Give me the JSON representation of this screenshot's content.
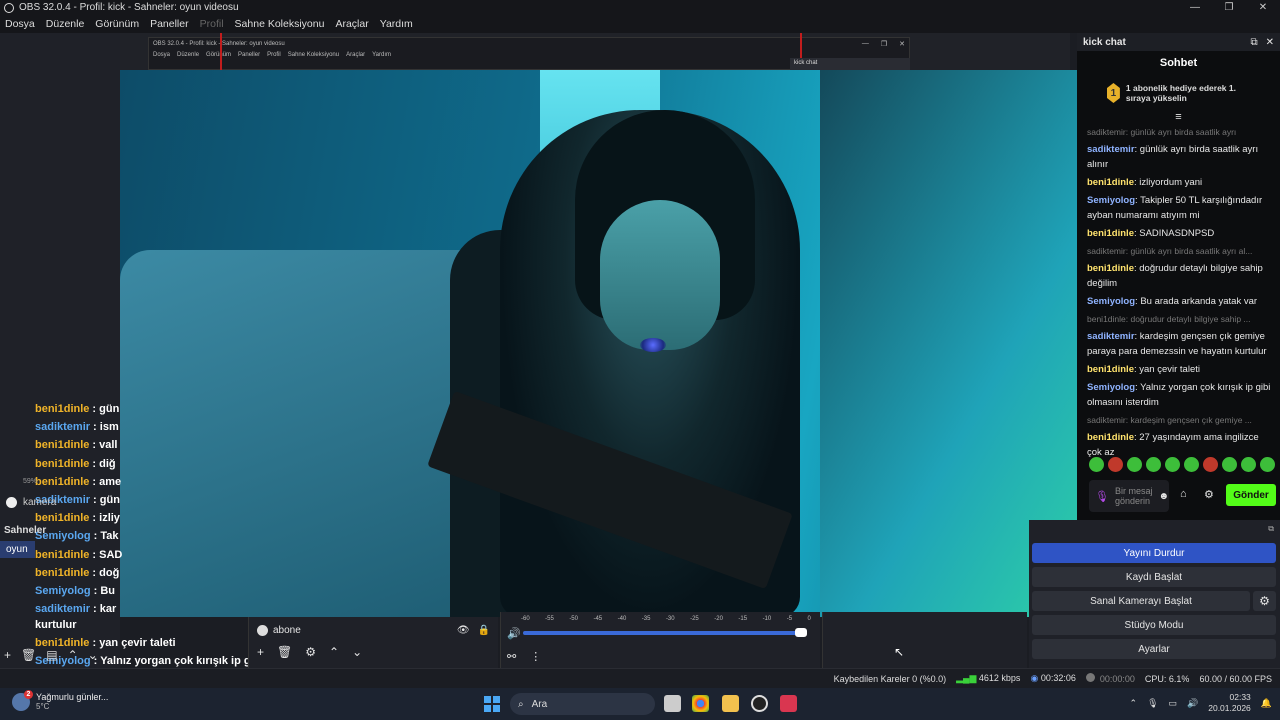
{
  "window": {
    "title": "OBS 32.0.4 - Profil: kick - Sahneler: oyun videosu",
    "controls": [
      "—",
      "❐",
      "✕"
    ]
  },
  "menu": {
    "items": [
      "Dosya",
      "Düzenle",
      "Görünüm",
      "Paneller",
      "Profil",
      "Sahne Koleksiyonu",
      "Araçlar",
      "Yardım"
    ]
  },
  "nested_preview": {
    "title": "OBS 32.0.4 - Profil: kick - Sahneler: oyun videosu",
    "menu": [
      "Dosya",
      "Düzenle",
      "Görünüm",
      "Paneller",
      "Profil",
      "Sahne Koleksiyonu",
      "Araçlar",
      "Yardım"
    ],
    "dock_title": "kick chat",
    "controls": [
      "—",
      "❐",
      "✕"
    ]
  },
  "left_chat": [
    {
      "name": "beni1dinle",
      "msg": "gün",
      "color": "gold"
    },
    {
      "name": "sadiktemir",
      "msg": "ism",
      "color": "blue"
    },
    {
      "name": "beni1dinle",
      "msg": "vall",
      "color": "gold"
    },
    {
      "name": "beni1dinle",
      "msg": "diğ",
      "color": "gold"
    },
    {
      "name": "beni1dinle",
      "msg": "ame",
      "color": "gold"
    },
    {
      "name": "sadiktemir",
      "msg": "gün",
      "color": "blue"
    },
    {
      "name": "beni1dinle",
      "msg": "izliy",
      "color": "gold"
    },
    {
      "name": "Semiyolog",
      "msg": "Tak",
      "color": "blue"
    },
    {
      "name": "beni1dinle",
      "msg": "SAD",
      "color": "gold"
    },
    {
      "name": "beni1dinle",
      "msg": "doğ",
      "color": "gold"
    },
    {
      "name": "Semiyolog",
      "msg": "Bu",
      "color": "blue"
    },
    {
      "name": "sadiktemir",
      "msg": "kar",
      "color": "blue"
    }
  ],
  "left_chat_tail": {
    "kurtulur": "kurtulur",
    "yan_name": "beni1dinle",
    "yan_msg": "yan çevir taleti",
    "last_name": "Semiyolog",
    "last_msg": "Yalnız yorgan çok kırışık ip gibi olmasını isterdim"
  },
  "scenes": {
    "header": "Sahneler",
    "selected": "oyun",
    "zoom": "59%",
    "camera_label": "kamera"
  },
  "sources": {
    "item": "abone"
  },
  "mixer": {
    "ticks": [
      "-60",
      "-55",
      "-50",
      "-45",
      "-40",
      "-35",
      "-30",
      "-25",
      "-20",
      "-15",
      "-10",
      "-5",
      "0"
    ],
    "volume_level": 1.0
  },
  "controls": {
    "stop_stream": "Yayını Durdur",
    "start_record": "Kaydı Başlat",
    "start_vcam": "Sanal Kamerayı Başlat",
    "studio_mode": "Stüdyo Modu",
    "settings": "Ayarlar"
  },
  "kick_chat": {
    "dock_title": "kick chat",
    "heading": "Sohbet",
    "sub_badge": "1",
    "sub_text": "1 abonelik hediye ederek 1. sıraya yükselin",
    "messages": [
      {
        "type": "sys",
        "text": "sadiktemir: günlük ayrı birda saatlik ayrı"
      },
      {
        "user": "sadiktemir",
        "color": "b",
        "text": ": günlük ayrı birda saatlik ayrı alınır"
      },
      {
        "user": "beni1dinle",
        "color": "g",
        "text": ": izliyordum yani"
      },
      {
        "user": "Semiyolog",
        "color": "b",
        "text": ": Takipler 50 TL karşılığındadır ayban numaramı atıyım mi"
      },
      {
        "user": "beni1dinle",
        "color": "g",
        "text": ": SADINASDNPSD"
      },
      {
        "type": "sys",
        "text": "sadiktemir: günlük ayrı birda saatlik ayrı al..."
      },
      {
        "user": "beni1dinle",
        "color": "g",
        "text": ": doğrudur detaylı bilgiye sahip değilim"
      },
      {
        "user": "Semiyolog",
        "color": "b",
        "text": ": Bu arada arkanda yatak var"
      },
      {
        "type": "sys",
        "text": "beni1dinle: doğrudur detaylı bilgiye sahip ..."
      },
      {
        "user": "sadiktemir",
        "color": "b",
        "text": ": kardeşim gençsen çık gemiye paraya para demezssin ve hayatın kurtulur"
      },
      {
        "user": "beni1dinle",
        "color": "g",
        "text": ": yan çevir taleti"
      },
      {
        "user": "Semiyolog",
        "color": "b",
        "text": ": Yalnız yorgan çok kırışık ip gibi olmasını isterdim"
      },
      {
        "type": "sys",
        "text": "sadiktemir: kardeşim gençsen çık gemiye ..."
      },
      {
        "user": "beni1dinle",
        "color": "g",
        "text": ": 27 yaşındayım ama ingilizce çok az"
      }
    ],
    "input_placeholder": "Bir mesaj gönderin",
    "send_label": "Gönder"
  },
  "status": {
    "dropped_frames": "Kaybedilen Kareler 0 (%0.0)",
    "bitrate": "4612 kbps",
    "stream_time": "00:32:06",
    "record_time": "00:00:00",
    "cpu": "CPU: 6.1%",
    "fps": "60.00 / 60.00 FPS"
  },
  "taskbar": {
    "weather_title": "Yağmurlu günler...",
    "weather_temp": "5°C",
    "weather_badge": "2",
    "search_placeholder": "Ara",
    "time": "02:33",
    "date": "20.01.2026"
  },
  "colors": {
    "accent": "#2f54c5",
    "kick_green": "#53fc18",
    "gold_name": "#f0b429",
    "blue_name": "#5aa7f0"
  }
}
